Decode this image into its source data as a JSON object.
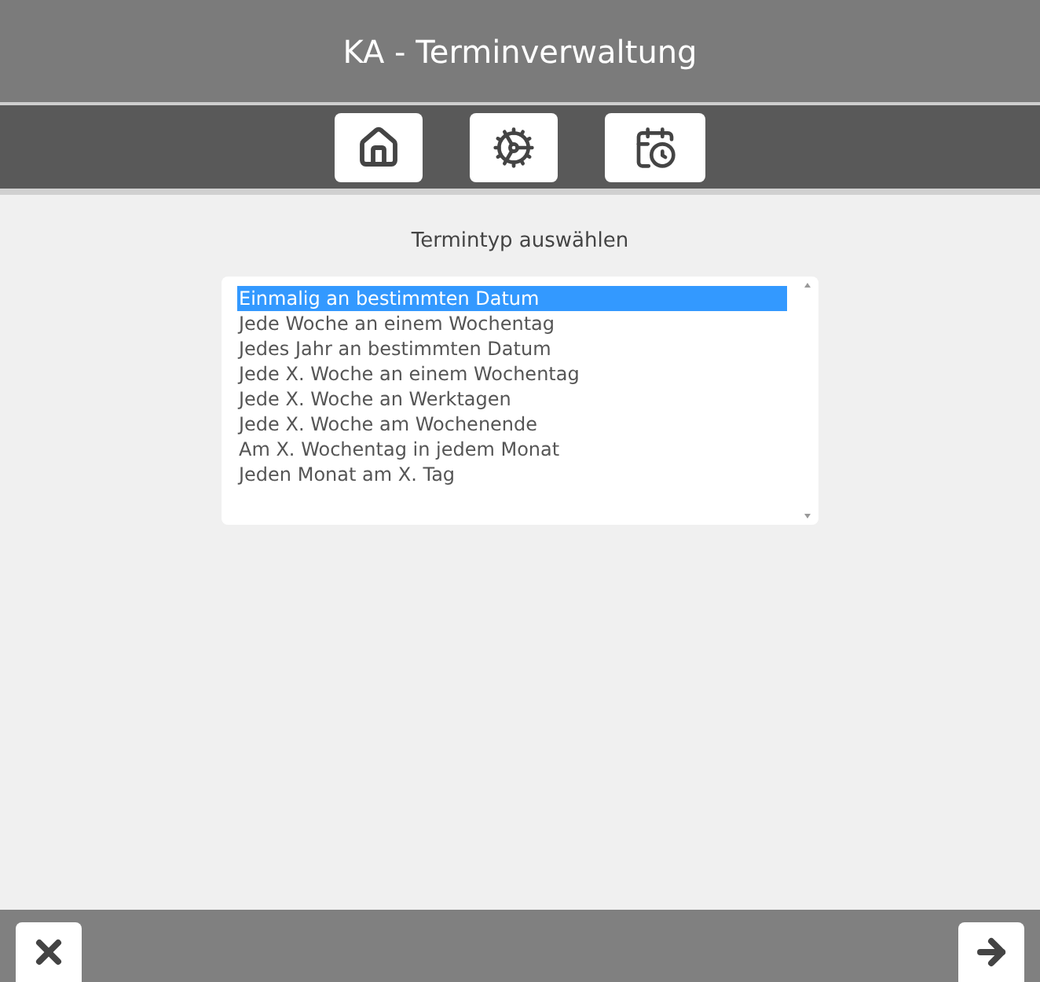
{
  "window": {
    "title": "KA - Terminverwaltung"
  },
  "heading": "Termintyp auswählen",
  "options": [
    {
      "label": "Einmalig an bestimmten Datum",
      "selected": true
    },
    {
      "label": "Jede Woche an einem Wochentag",
      "selected": false
    },
    {
      "label": "Jedes Jahr an bestimmten Datum",
      "selected": false
    },
    {
      "label": "Jede X. Woche an einem Wochentag",
      "selected": false
    },
    {
      "label": "Jede X. Woche an Werktagen",
      "selected": false
    },
    {
      "label": "Jede X. Woche am Wochenende",
      "selected": false
    },
    {
      "label": "Am X. Wochentag in jedem Monat",
      "selected": false
    },
    {
      "label": "Jeden Monat am X. Tag",
      "selected": false
    }
  ]
}
